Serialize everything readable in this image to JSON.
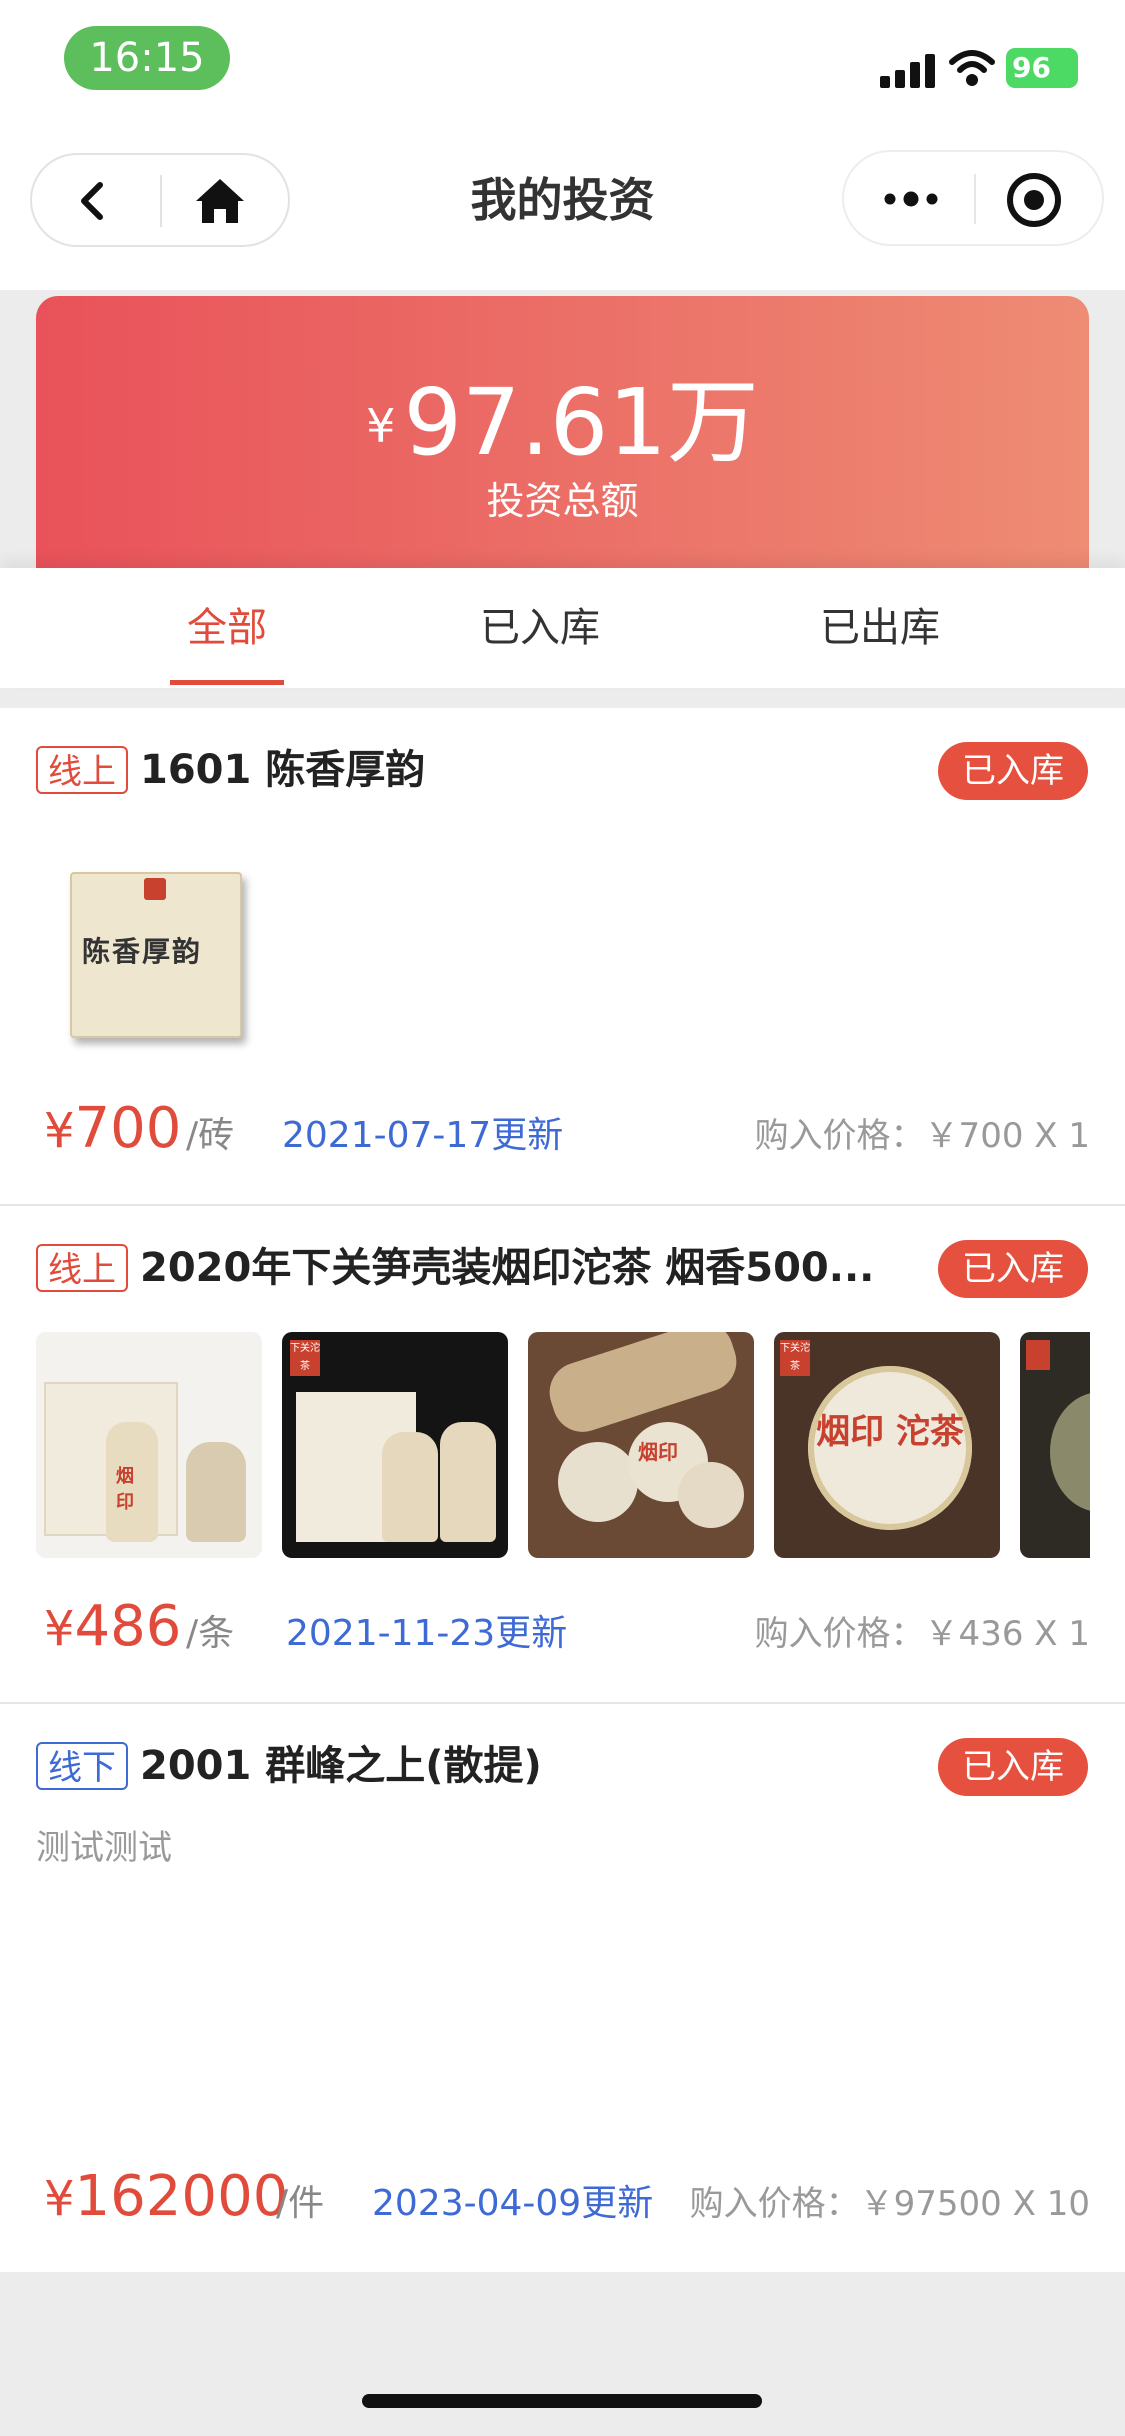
{
  "status_bar": {
    "time": "16:15",
    "battery": "96"
  },
  "nav": {
    "title": "我的投资",
    "back_icon": "chevron-left-icon",
    "home_icon": "home-icon",
    "more_icon": "more-dots-icon",
    "target_icon": "target-icon"
  },
  "summary": {
    "currency": "¥",
    "amount": "97.61万",
    "label": "投资总额"
  },
  "tabs": [
    {
      "label": "全部",
      "active": true
    },
    {
      "label": "已入库",
      "active": false
    },
    {
      "label": "已出库",
      "active": false
    }
  ],
  "items": [
    {
      "tag": "线上",
      "title": "1601 陈香厚韵",
      "status": "已入库",
      "price_currency": "¥",
      "price": "700",
      "unit": "/砖",
      "updated": "2021-07-17更新",
      "buy_price": "购入价格：￥700 X 1",
      "images": [
        "陈香厚韵"
      ]
    },
    {
      "tag": "线上",
      "title": "2020年下关笋壳装烟印沱茶 烟香500...",
      "status": "已入库",
      "price_currency": "¥",
      "price": "486",
      "unit": "/条",
      "updated": "2021-11-23更新",
      "buy_price": "购入价格：￥436 X 1",
      "images": [
        "烟印",
        "下关沱茶",
        "烟印",
        "烟印 沱茶",
        "下关沱茶"
      ]
    },
    {
      "tag": "线下",
      "title": "2001 群峰之上(散提)",
      "status": "已入库",
      "note": "测试测试",
      "price_currency": "¥",
      "price": "162000",
      "unit": "/件",
      "updated": "2023-04-09更新",
      "buy_price": "购入价格：￥97500 X 10"
    }
  ],
  "colors": {
    "accent": "#e14b3b",
    "link": "#3e6ad6",
    "badge": "#e6503e"
  }
}
